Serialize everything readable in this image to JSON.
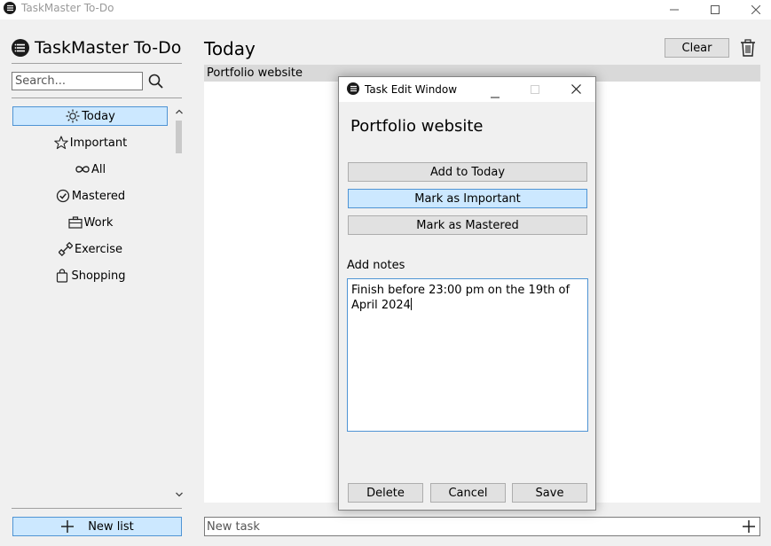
{
  "window": {
    "title": "TaskMaster To-Do"
  },
  "sidebar": {
    "app_name": "TaskMaster To-Do",
    "search_placeholder": "Search...",
    "items": [
      {
        "label": "Today",
        "icon": "sun-icon",
        "selected": true
      },
      {
        "label": "Important",
        "icon": "star-icon",
        "selected": false
      },
      {
        "label": "All",
        "icon": "infinity-icon",
        "selected": false
      },
      {
        "label": "Mastered",
        "icon": "check-circle-icon",
        "selected": false
      },
      {
        "label": "Work",
        "icon": "briefcase-icon",
        "selected": false
      },
      {
        "label": "Exercise",
        "icon": "dumbbell-icon",
        "selected": false
      },
      {
        "label": "Shopping",
        "icon": "shopping-bag-icon",
        "selected": false
      }
    ],
    "new_list_label": "New list"
  },
  "main": {
    "title": "Today",
    "clear_label": "Clear",
    "tasks": [
      {
        "name": "Portfolio website"
      }
    ],
    "new_task_placeholder": "New task"
  },
  "dialog": {
    "title": "Task Edit Window",
    "task_name": "Portfolio website",
    "add_today_label": "Add to Today",
    "mark_important_label": "Mark as Important",
    "mark_mastered_label": "Mark as Mastered",
    "notes_label": "Add notes",
    "notes_text": "Finish before 23:00 pm on the 19th of April 2024",
    "delete_label": "Delete",
    "cancel_label": "Cancel",
    "save_label": "Save"
  },
  "colors": {
    "selection_fill": "#cce8ff",
    "selection_border": "#4f94d4",
    "button_fill": "#e1e1e1",
    "window_bg": "#f0f0f0"
  }
}
